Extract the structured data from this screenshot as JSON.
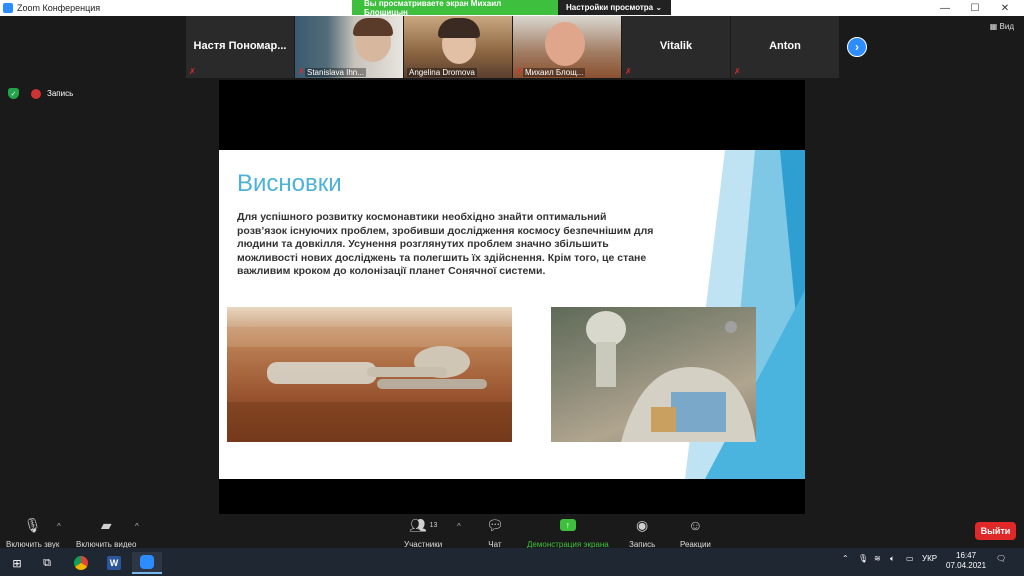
{
  "window": {
    "title": "Zoom Конференция",
    "minimize": "—",
    "maximize": "☐",
    "close": "✕"
  },
  "share_banner": {
    "message": "Вы просматриваете экран Михаил Блощицын",
    "view_options": "Настройки просмотра ⌄"
  },
  "participants": [
    {
      "name": "Настя  Пономар...",
      "muted": true,
      "video": false
    },
    {
      "name": "Stanislava Ihn...",
      "muted": true,
      "video": true
    },
    {
      "name": "Angelina Dromova",
      "muted": false,
      "video": true
    },
    {
      "name": "Михаил Блощ...",
      "muted": true,
      "video": true
    },
    {
      "name": "Vitalik",
      "muted": true,
      "video": false
    },
    {
      "name": "Anton",
      "muted": true,
      "video": false
    }
  ],
  "gallery": {
    "next": "›",
    "view_label": "Вид"
  },
  "status": {
    "recording_label": "Запись"
  },
  "slide": {
    "title": "Висновки",
    "body": "Для успішного розвитку космонавтики необхідно знайти оптимальний розв’язок існуючих проблем, зробивши дослідження космосу безпечнішим для людини та довкілля. Усунення розглянутих проблем значно збільшить можливості нових досліджень та полегшить їх здійснення. Крім того, це стане важливим кроком до колонізації планет Сонячної системи."
  },
  "toolbar": {
    "audio_label": "Включить звук",
    "video_label": "Включить видео",
    "participants_label": "Участники",
    "participants_count": "13",
    "chat_label": "Чат",
    "share_label": "Демонстрация экрана",
    "record_label": "Запись",
    "reactions_label": "Реакции",
    "leave_label": "Выйти"
  },
  "taskbar": {
    "language": "УКР",
    "time": "16:47",
    "date": "07.04.2021"
  },
  "colors": {
    "zoom_blue": "#2d8cff",
    "share_green": "#3ec03e",
    "leave_red": "#e02828",
    "slide_title": "#4db2d6"
  }
}
